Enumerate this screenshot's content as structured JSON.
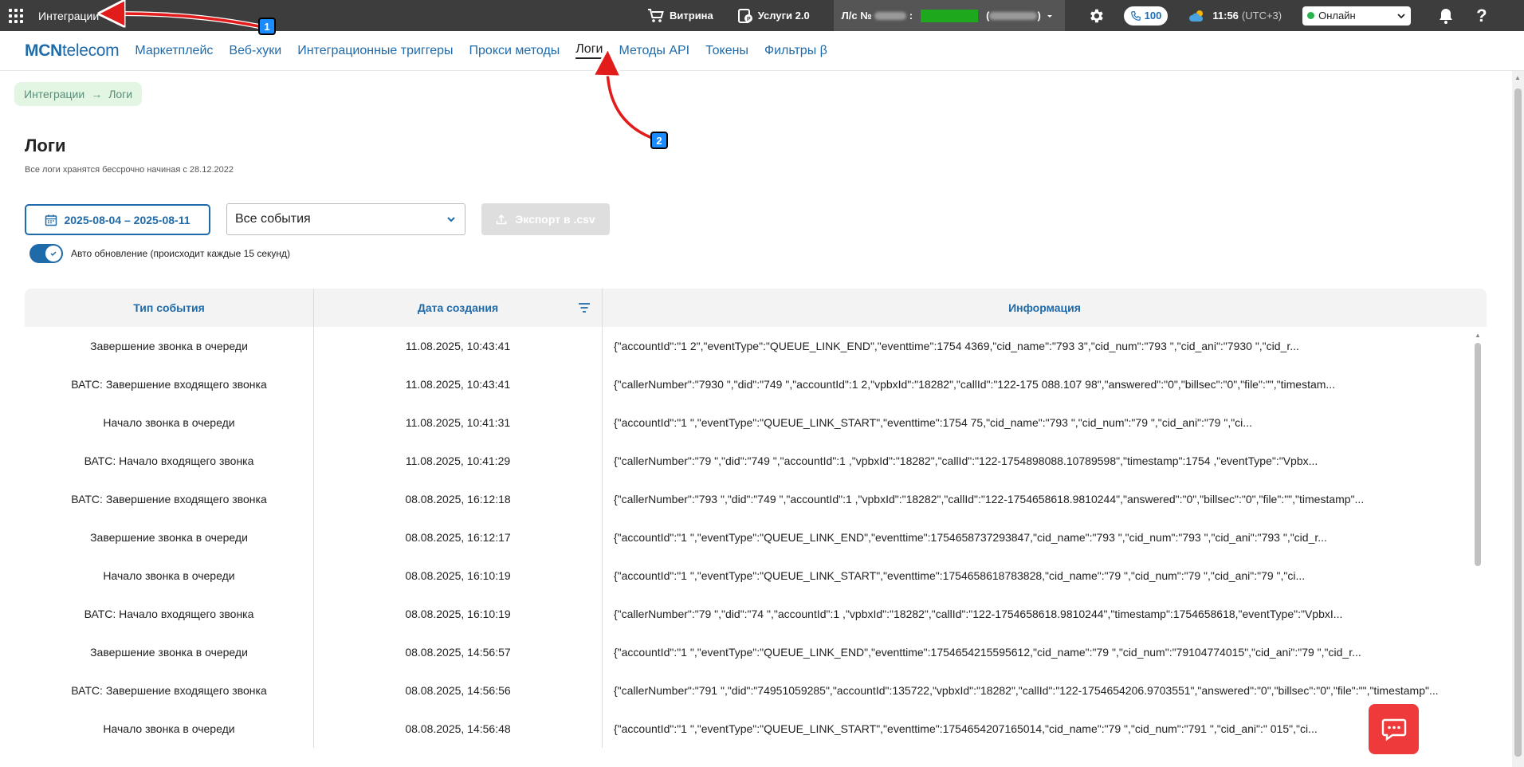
{
  "topbar": {
    "title": "Интеграции",
    "vitrina": "Витрина",
    "services": "Услуги 2.0",
    "account_prefix": "Л/с №",
    "account_sep": ":",
    "calls_count": "100",
    "time": "11:56",
    "timezone": "(UTC+3)",
    "status": "Онлайн",
    "help": "?"
  },
  "nav": {
    "logo_bold": "MCN",
    "logo_rest": "telecom",
    "links": [
      "Маркетплейс",
      "Веб-хуки",
      "Интеграционные триггеры",
      "Прокси методы",
      "Логи",
      "Методы API",
      "Токены",
      "Фильтры β"
    ],
    "active_index": 4
  },
  "breadcrumb": {
    "parent": "Интеграции",
    "arrow": "→",
    "current": "Логи"
  },
  "page": {
    "title": "Логи",
    "subtitle": "Все логи хранятся бессрочно начиная с 28.12.2022"
  },
  "controls": {
    "date_range": "2025-08-04 – 2025-08-11",
    "event_filter": "Все события",
    "export_label": "Экспорт в .csv",
    "auto_update_label": "Авто обновление (происходит каждые 15 секунд)",
    "auto_update_on": true
  },
  "table": {
    "headers": [
      "Тип события",
      "Дата создания",
      "Информация"
    ],
    "rows": [
      {
        "type": "Завершение звонка в очереди",
        "date": "11.08.2025, 10:43:41",
        "info": "{\"accountId\":\"1      2\",\"eventType\":\"QUEUE_LINK_END\",\"eventtime\":1754          4369,\"cid_name\":\"793          3\",\"cid_num\":\"793          \",\"cid_ani\":\"7930          \",\"cid_r..."
      },
      {
        "type": "ВАТС: Завершение входящего звонка",
        "date": "11.08.2025, 10:43:41",
        "info": "{\"callerNumber\":\"7930          \",\"did\":\"749          \",\"accountId\":1      2,\"vpbxId\":\"18282\",\"callId\":\"122-175     088.107     98\",\"answered\":\"0\",\"billsec\":\"0\",\"file\":\"\",\"timestam..."
      },
      {
        "type": "Начало звонка в очереди",
        "date": "11.08.2025, 10:41:31",
        "info": "{\"accountId\":\"1        \",\"eventType\":\"QUEUE_LINK_START\",\"eventtime\":1754            75,\"cid_name\":\"793          \",\"cid_num\":\"79          \",\"cid_ani\":\"79          \",\"ci..."
      },
      {
        "type": "ВАТС: Начало входящего звонка",
        "date": "11.08.2025, 10:41:29",
        "info": "{\"callerNumber\":\"79          \",\"did\":\"749          \",\"accountId\":1      ,\"vpbxId\":\"18282\",\"callId\":\"122-1754898088.10789598\",\"timestamp\":1754        ,\"eventType\":\"Vpbx..."
      },
      {
        "type": "ВАТС: Завершение входящего звонка",
        "date": "08.08.2025, 16:12:18",
        "info": "{\"callerNumber\":\"793          \",\"did\":\"749          \",\"accountId\":1      ,\"vpbxId\":\"18282\",\"callId\":\"122-1754658618.9810244\",\"answered\":\"0\",\"billsec\":\"0\",\"file\":\"\",\"timestamp\"..."
      },
      {
        "type": "Завершение звонка в очереди",
        "date": "08.08.2025, 16:12:17",
        "info": "{\"accountId\":\"1      \",\"eventType\":\"QUEUE_LINK_END\",\"eventtime\":1754658737293847,\"cid_name\":\"793          \",\"cid_num\":\"793          \",\"cid_ani\":\"793          \",\"cid_r..."
      },
      {
        "type": "Начало звонка в очереди",
        "date": "08.08.2025, 16:10:19",
        "info": "{\"accountId\":\"1      \",\"eventType\":\"QUEUE_LINK_START\",\"eventtime\":1754658618783828,\"cid_name\":\"79          \",\"cid_num\":\"79          \",\"cid_ani\":\"79          \",\"ci..."
      },
      {
        "type": "ВАТС: Начало входящего звонка",
        "date": "08.08.2025, 16:10:19",
        "info": "{\"callerNumber\":\"79          \",\"did\":\"74          \",\"accountId\":1      ,\"vpbxId\":\"18282\",\"callId\":\"122-1754658618.9810244\",\"timestamp\":1754658618,\"eventType\":\"VpbxI..."
      },
      {
        "type": "Завершение звонка в очереди",
        "date": "08.08.2025, 14:56:57",
        "info": "{\"accountId\":\"1      \",\"eventType\":\"QUEUE_LINK_END\",\"eventtime\":1754654215595612,\"cid_name\":\"79          \",\"cid_num\":\"79104774015\",\"cid_ani\":\"79          \",\"cid_r..."
      },
      {
        "type": "ВАТС: Завершение входящего звонка",
        "date": "08.08.2025, 14:56:56",
        "info": "{\"callerNumber\":\"791          \",\"did\":\"74951059285\",\"accountId\":135722,\"vpbxId\":\"18282\",\"callId\":\"122-1754654206.9703551\",\"answered\":\"0\",\"billsec\":\"0\",\"file\":\"\",\"timestamp\"..."
      },
      {
        "type": "Начало звонка в очереди",
        "date": "08.08.2025, 14:56:48",
        "info": "{\"accountId\":\"1      \",\"eventType\":\"QUEUE_LINK_START\",\"eventtime\":1754654207165014,\"cid_name\":\"79          \",\"cid_num\":\"791          \",\"cid_ani\":\"          015\",\"ci..."
      }
    ]
  },
  "annotations": {
    "badge1": "1",
    "badge2": "2"
  },
  "colors": {
    "brand": "#1f6aa8",
    "topbar": "#3d3d3d",
    "annotation_arrow": "#e21b1b",
    "chat_button": "#ee3a3a"
  }
}
